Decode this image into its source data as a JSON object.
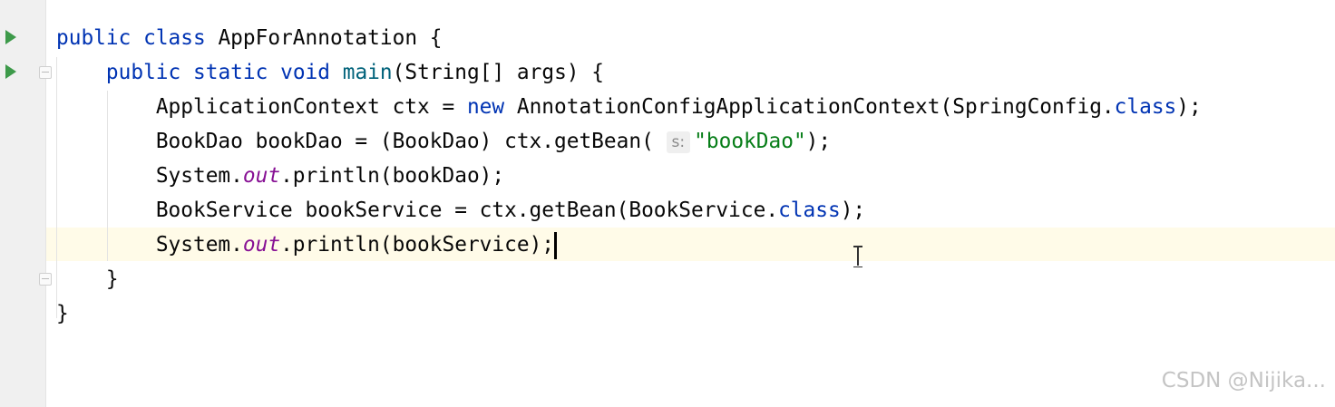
{
  "editor": {
    "lines": {
      "l1": {
        "kw1": "public",
        "kw2": "class",
        "name": "AppForAnnotation",
        "brace": "{"
      },
      "l2": {
        "kw1": "public",
        "kw2": "static",
        "kw3": "void",
        "method": "main",
        "params": "(String[] args)",
        "brace": "{"
      },
      "l3": {
        "a": "ApplicationContext ctx = ",
        "kw": "new",
        "b": "AnnotationConfigApplicationContext(SpringConfig.",
        "cls": "class",
        "c": ");"
      },
      "l4": {
        "a": "BookDao bookDao = (BookDao) ctx.getBean(",
        "hint": "s:",
        "str": "\"bookDao\"",
        "c": ");"
      },
      "l5": {
        "a": "System.",
        "field": "out",
        "b": ".println(bookDao);"
      },
      "l6": {
        "a": "BookService bookService = ctx.getBean(BookService.",
        "cls": "class",
        "c": ");"
      },
      "l7": {
        "a": "System.",
        "field": "out",
        "b": ".println(bookService);"
      },
      "l8": {
        "brace": "}"
      },
      "l9": {
        "brace": "}"
      }
    }
  },
  "watermark": "CSDN @Nijika...",
  "colors": {
    "keyword": "#0033b3",
    "method": "#00627a",
    "string": "#067d17",
    "static_field": "#871094",
    "current_line": "#fffbe8",
    "run_icon": "#3d9a4a"
  }
}
